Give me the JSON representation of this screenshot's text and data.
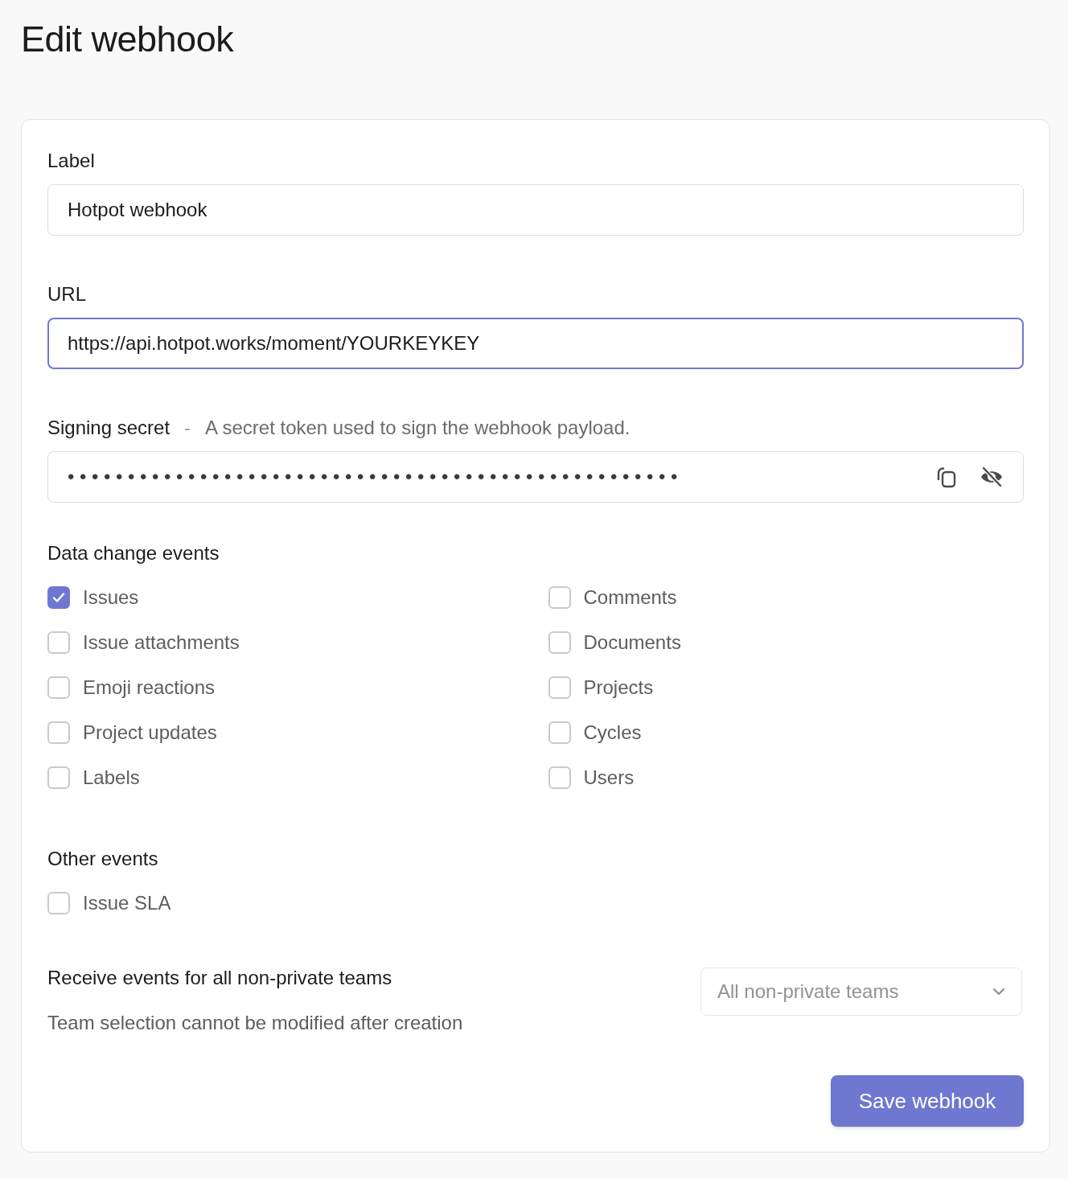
{
  "title": "Edit webhook",
  "label_field": {
    "label": "Label",
    "value": "Hotpot webhook",
    "focused": false
  },
  "url_field": {
    "label": "URL",
    "value": "https://api.hotpot.works/moment/YOURKEYKEY",
    "focused": true
  },
  "secret_field": {
    "label": "Signing secret",
    "separator": "-",
    "hint": "A secret token used to sign the webhook payload.",
    "value": "•••••••••••••••••••••••••••••••••••••••••••••••••••"
  },
  "data_change_events": {
    "heading": "Data change events",
    "items": [
      {
        "label": "Issues",
        "checked": true
      },
      {
        "label": "Comments",
        "checked": false
      },
      {
        "label": "Issue attachments",
        "checked": false
      },
      {
        "label": "Documents",
        "checked": false
      },
      {
        "label": "Emoji reactions",
        "checked": false
      },
      {
        "label": "Projects",
        "checked": false
      },
      {
        "label": "Project updates",
        "checked": false
      },
      {
        "label": "Cycles",
        "checked": false
      },
      {
        "label": "Labels",
        "checked": false
      },
      {
        "label": "Users",
        "checked": false
      }
    ]
  },
  "other_events": {
    "heading": "Other events",
    "items": [
      {
        "label": "Issue SLA",
        "checked": false
      }
    ]
  },
  "teams": {
    "heading": "Receive events for all non-private teams",
    "note": "Team selection cannot be modified after creation",
    "select": {
      "value": "All non-private teams",
      "disabled": true
    }
  },
  "save_button": "Save webhook"
}
